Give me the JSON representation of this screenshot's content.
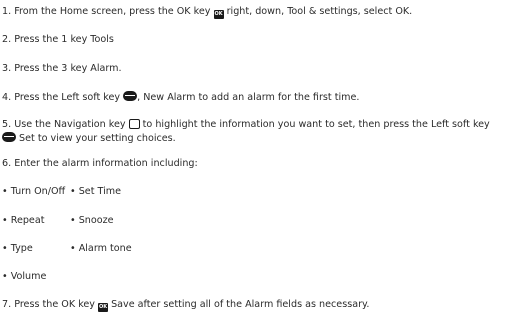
{
  "steps": {
    "s1": {
      "pre": "1. From the Home screen, press the OK key",
      "key": "OK",
      "post": " right, down, Tool & settings, select OK."
    },
    "s2": "2. Press the 1 key Tools",
    "s3": "3. Press the 3 key Alarm.",
    "s4": {
      "pre": "4. Press the Left soft key ",
      "post": ", New Alarm to add an alarm for the first time."
    },
    "s5": {
      "pre": "5. Use the Navigation key ",
      "post": " to highlight the information you want to set, then press the Left soft key",
      "line2": " Set to view your setting choices."
    },
    "s6": "6. Enter the alarm information including:",
    "s7": {
      "pre": "7. Press the OK key ",
      "key": "OK",
      "post": " Save after setting all of the Alarm fields as necessary."
    }
  },
  "bullets": {
    "turn_on_off": "• Turn On/Off",
    "set_time": "• Set Time",
    "repeat": "• Repeat",
    "snooze": "• Snooze",
    "type": "• Type",
    "alarm_tone": "• Alarm tone",
    "volume": "• Volume"
  },
  "icons": {
    "ok_key": "ok-key-icon",
    "left_soft_key": "left-soft-key-icon",
    "navigation_key": "navigation-key-icon"
  }
}
